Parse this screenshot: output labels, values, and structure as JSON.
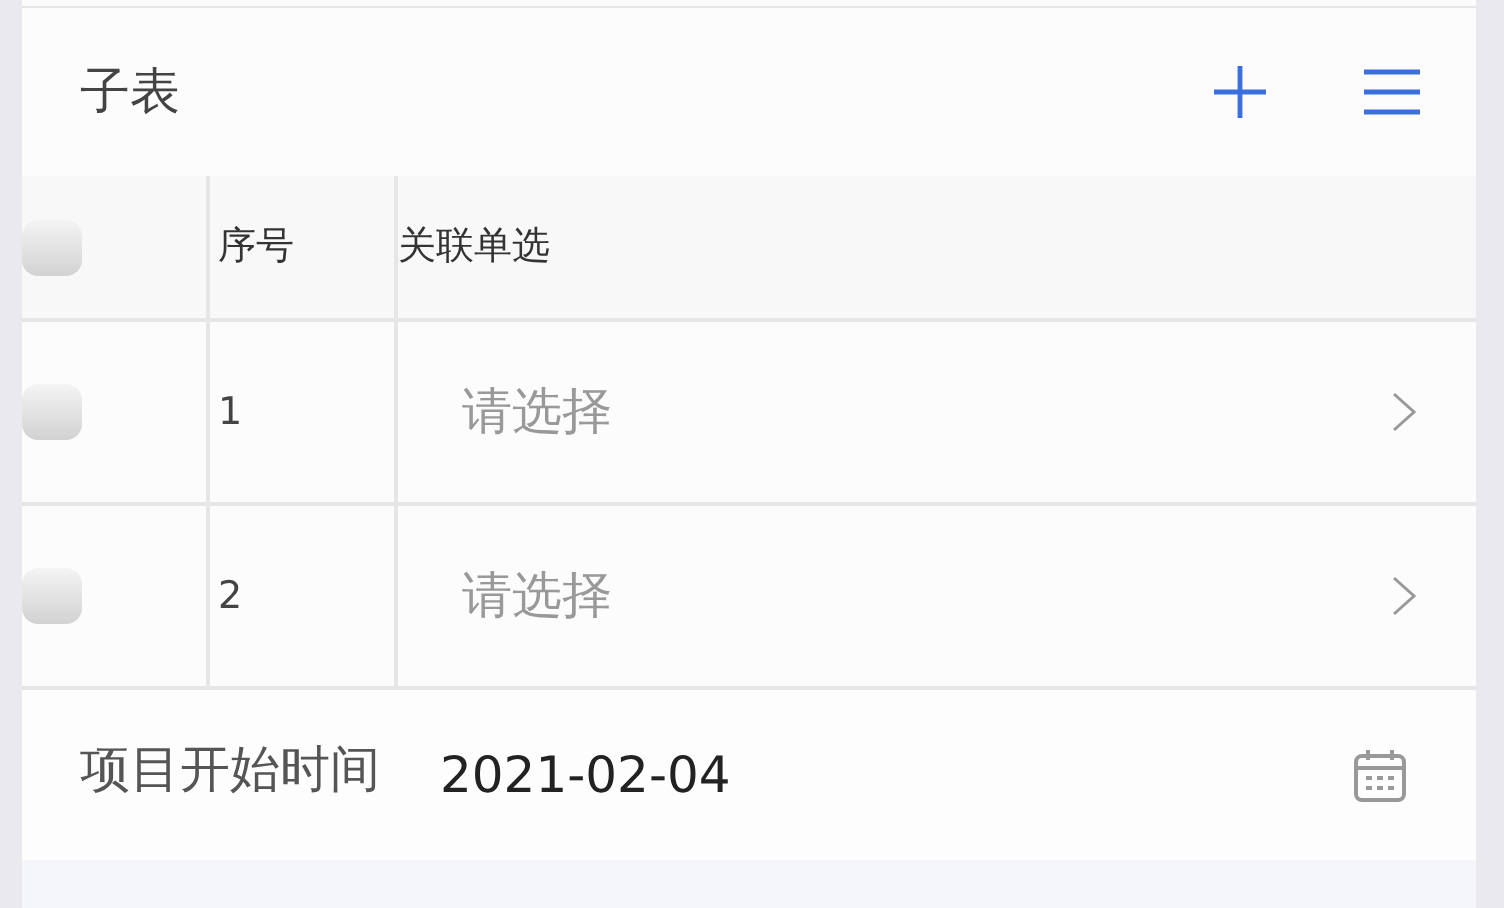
{
  "section": {
    "title": "子表"
  },
  "table": {
    "header_checkbox": {
      "checked": false
    },
    "columns": [
      "序号",
      "关联单选"
    ],
    "rows": [
      {
        "checked": false,
        "index": "1",
        "placeholder": "请选择"
      },
      {
        "checked": false,
        "index": "2",
        "placeholder": "请选择"
      }
    ]
  },
  "date_field": {
    "label": "项目开始时间",
    "value": "2021-02-04"
  }
}
